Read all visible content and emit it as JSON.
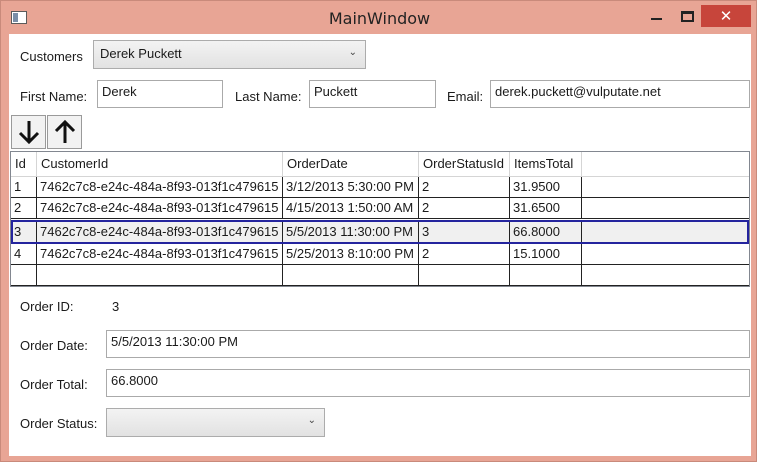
{
  "window": {
    "title": "MainWindow",
    "close_glyph": "✕"
  },
  "customer": {
    "label": "Customers",
    "selected": "Derek Puckett"
  },
  "name_fields": {
    "first_label": "First Name:",
    "first_value": "Derek",
    "last_label": "Last Name:",
    "last_value": "Puckett",
    "email_label": "Email:",
    "email_value": "derek.puckett@vulputate.net"
  },
  "toolbar": {
    "down_icon": "arrow-down",
    "up_icon": "arrow-up"
  },
  "grid": {
    "columns": [
      "Id",
      "CustomerId",
      "OrderDate",
      "OrderStatusId",
      "ItemsTotal"
    ],
    "rows": [
      [
        "1",
        "7462c7c8-e24c-484a-8f93-013f1c479615",
        "3/12/2013 5:30:00 PM",
        "2",
        "31.9500"
      ],
      [
        "2",
        "7462c7c8-e24c-484a-8f93-013f1c479615",
        "4/15/2013 1:50:00 AM",
        "2",
        "31.6500"
      ],
      [
        "3",
        "7462c7c8-e24c-484a-8f93-013f1c479615",
        "5/5/2013 11:30:00 PM",
        "3",
        "66.8000"
      ],
      [
        "4",
        "7462c7c8-e24c-484a-8f93-013f1c479615",
        "5/25/2013 8:10:00 PM",
        "2",
        "15.1000"
      ]
    ],
    "selected_row": 3
  },
  "detail": {
    "order_id_label": "Order ID:",
    "order_id_value": "3",
    "order_date_label": "Order Date:",
    "order_date_value": "5/5/2013 11:30:00 PM",
    "order_total_label": "Order Total:",
    "order_total_value": "66.8000",
    "order_status_label": "Order Status:",
    "order_status_value": ""
  }
}
